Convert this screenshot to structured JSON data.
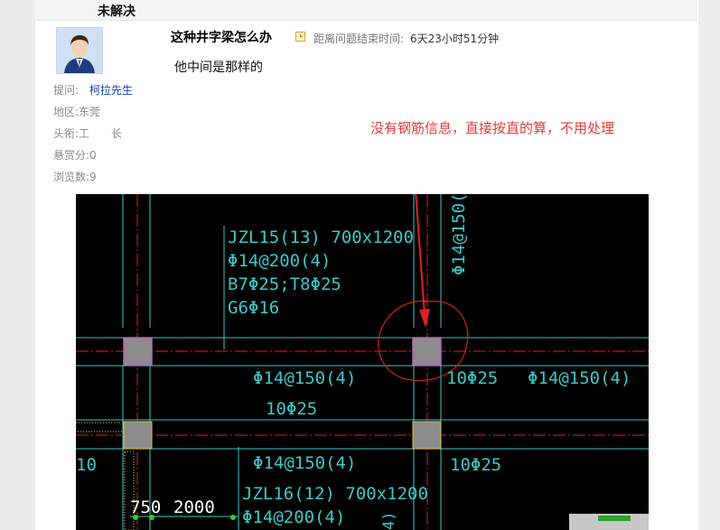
{
  "status": {
    "label": "未解决"
  },
  "question": {
    "title": "这种井字梁怎么办",
    "timer_label": "距离问题结束时间:",
    "timer_value": "6天23小时51分钟",
    "body": "他中间是那样的"
  },
  "meta": {
    "asker_label": "提问:",
    "asker_name": "柯拉先生",
    "region_label": "地区:",
    "region_value": "东莞",
    "rank_label": "头衔:",
    "rank_value": "工　　长",
    "bounty_label": "悬赏分:",
    "bounty_value": "0",
    "views_label": "浏览数:",
    "views_value": "9"
  },
  "annotation": {
    "text": "没有钢筋信息，直接按直的算，不用处理"
  },
  "drawing": {
    "label_jzl15": "JZL15(13) 700x1200",
    "label_stirrup_a": "Φ14@200(4)",
    "label_b7t8": "B7Φ25;T8Φ25",
    "label_g6": "G6Φ16",
    "label_stirrup_b": "Φ14@150(4)",
    "label_10_a": "10Φ25",
    "label_10_b": "10Φ25",
    "label_stirrup_c": "Φ14@150(4)",
    "label_stirrup_d": "Φ14@150(4)",
    "label_10_c": "10Φ25",
    "label_jzl16": "JZL16(12) 700x1200",
    "label_stirrup_e": "Φ14@200(4)",
    "label_vert": "Φ14@150(",
    "label_left_10": "10",
    "label_750": "750",
    "label_2000": "2000",
    "label_4": "4)"
  },
  "colors": {
    "cad_bg": "#000000",
    "cad_cyan": "#3cc8c8",
    "cad_red": "#e02020",
    "cad_column_gray": "#8c8c8c",
    "cad_column_magenta": "#c060c0",
    "annotation_red": "#e23a3a",
    "link_blue": "#1a3fb0"
  }
}
